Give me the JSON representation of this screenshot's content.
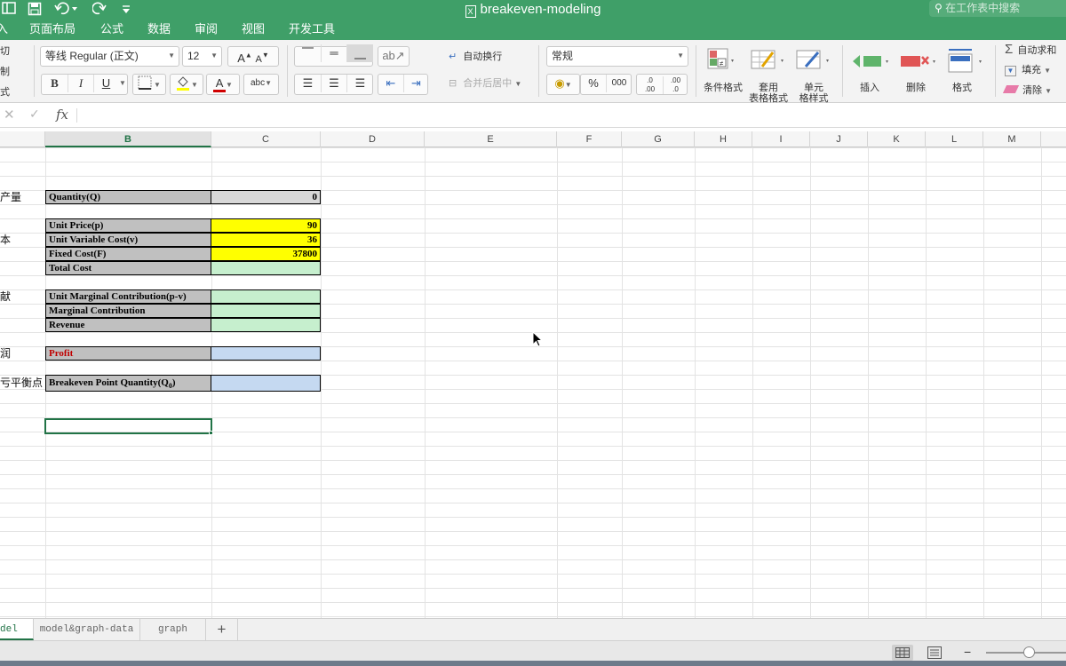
{
  "window": {
    "title": "breakeven-modeling"
  },
  "titlebar": {
    "search_placeholder": "在工作表中搜索"
  },
  "menu": {
    "items": [
      "入",
      "页面布局",
      "公式",
      "数据",
      "审阅",
      "视图",
      "开发工具"
    ]
  },
  "ribbon": {
    "clipboard": {
      "cut": "切",
      "copy": "制",
      "format_painter": "式"
    },
    "font": {
      "name": "等线 Regular (正文)",
      "size": "12",
      "grow": "A",
      "shrink": "A",
      "bold": "B",
      "italic": "I",
      "underline": "U",
      "font_color_glyph": "A",
      "phonetic_glyph": "abc"
    },
    "alignment": {
      "wrap_text": "自动换行",
      "merge_center": "合并后居中"
    },
    "number": {
      "format": "常规",
      "percent": "%",
      "comma": "000",
      "inc_decimal": ".0\n.00",
      "dec_decimal": ".00\n.0"
    },
    "styles": {
      "conditional": "条件格式",
      "table_1": "套用",
      "table_2": "表格格式",
      "cell_1": "单元",
      "cell_2": "格样式"
    },
    "cells": {
      "insert": "插入",
      "delete": "删除",
      "format": "格式"
    },
    "editing": {
      "autosum": "自动求和",
      "fill": "填充",
      "clear": "清除"
    }
  },
  "formula_bar": {
    "fx": "fx"
  },
  "columns": [
    "B",
    "C",
    "D",
    "E",
    "F",
    "G",
    "H",
    "I",
    "J",
    "K",
    "L",
    "M"
  ],
  "active_column": "B",
  "rows": [
    {
      "a": "产量",
      "b": "Quantity(Q)",
      "c": "0"
    },
    {
      "a": "",
      "b": "Unit Price(p)",
      "c": "90"
    },
    {
      "a": "本",
      "b": "Unit Variable Cost(v)",
      "c": "36"
    },
    {
      "a": "",
      "b": "Fixed Cost(F)",
      "c": "37800"
    },
    {
      "a": "",
      "b": "Total Cost",
      "c": ""
    },
    {
      "a": "献",
      "b": "Unit Marginal Contribution(p-v)",
      "c": ""
    },
    {
      "a": "",
      "b": "Marginal Contribution",
      "c": ""
    },
    {
      "a": "",
      "b": "Revenue",
      "c": ""
    },
    {
      "a": "润",
      "b": "Profit",
      "c": ""
    },
    {
      "a": "亏平衡点",
      "b": "Breakeven Point Quantity(Q",
      "b_sub": "0",
      "b_close": ")",
      "c": ""
    }
  ],
  "colors": {
    "input": "#ffff00",
    "calc": "#c6efce",
    "result": "#c5d9f1",
    "label": "#c0c0c0",
    "accent": "#217346"
  },
  "sheets": [
    "del",
    "model&graph-data",
    "graph"
  ],
  "active_sheet": "del",
  "add_sheet": "+",
  "status": {
    "zoom_minus": "−"
  }
}
